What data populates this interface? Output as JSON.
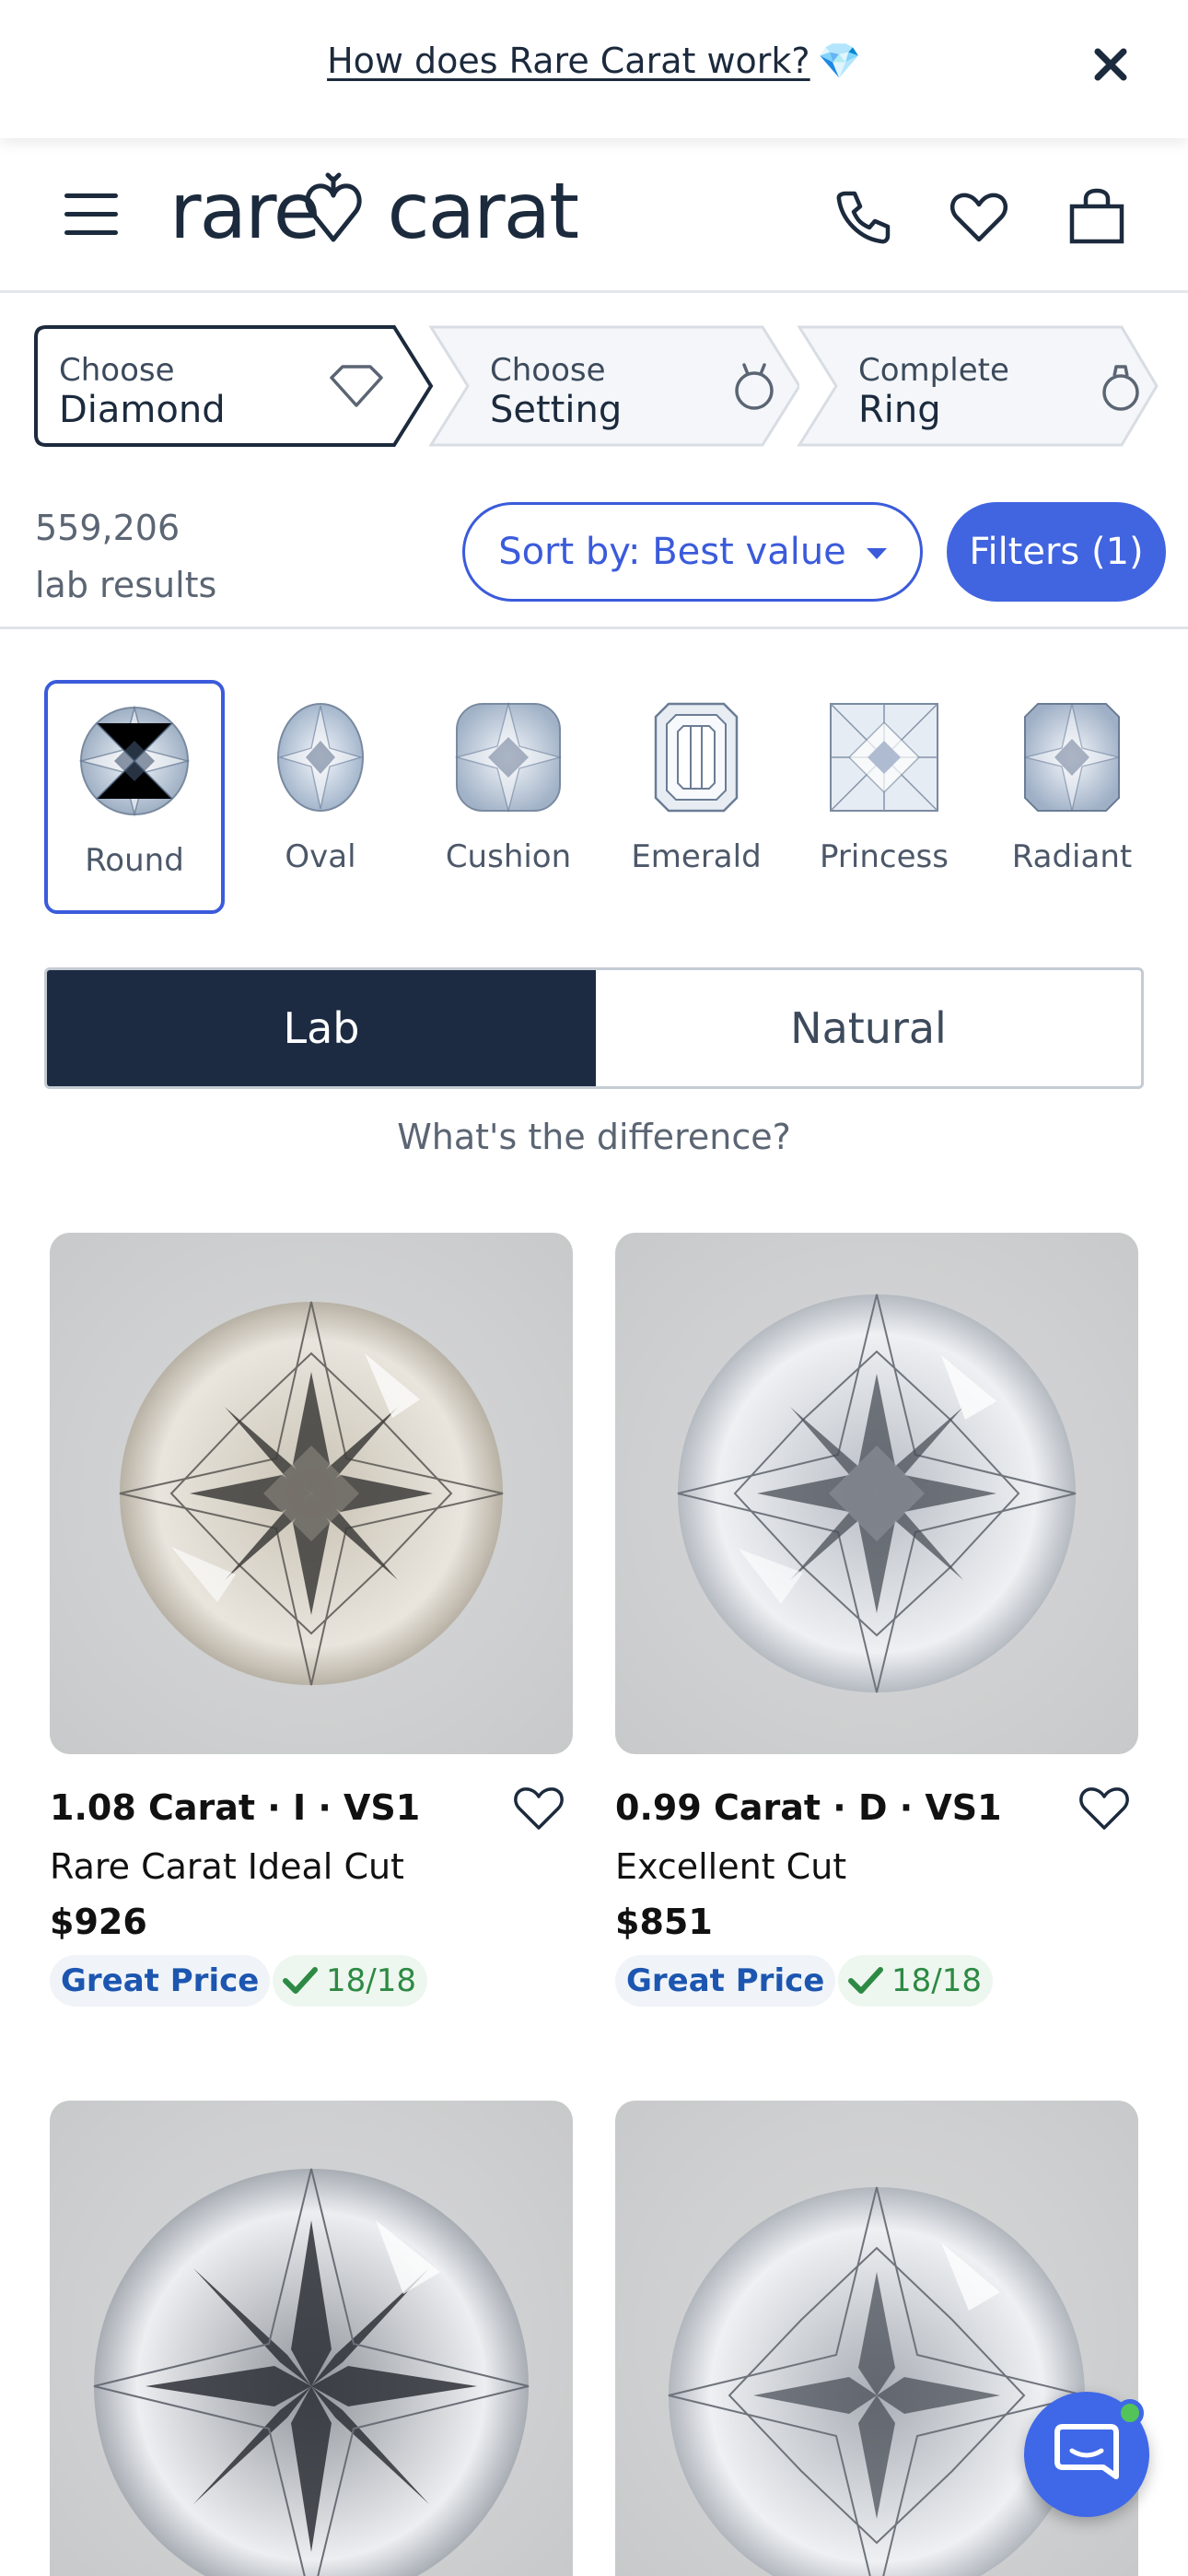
{
  "banner": {
    "link_text": "How does Rare Carat work?",
    "gem_glyph": "💎",
    "close_icon": "close-icon"
  },
  "header": {
    "logo": "rare carat",
    "icons": [
      "menu-icon",
      "phone-icon",
      "heart-icon",
      "bag-icon"
    ]
  },
  "steps": [
    {
      "small": "Choose",
      "big": "Diamond",
      "icon": "diamond-outline-icon",
      "active": true
    },
    {
      "small": "Choose",
      "big": "Setting",
      "icon": "setting-icon",
      "active": false
    },
    {
      "small": "Complete",
      "big": "Ring",
      "icon": "ring-icon",
      "active": false
    }
  ],
  "results": {
    "count": "559,206",
    "label": "lab results"
  },
  "sort": {
    "label": "Sort by: Best value"
  },
  "filters": {
    "label": "Filters (1)"
  },
  "shapes": [
    {
      "label": "Round",
      "selected": true
    },
    {
      "label": "Oval",
      "selected": false
    },
    {
      "label": "Cushion",
      "selected": false
    },
    {
      "label": "Emerald",
      "selected": false
    },
    {
      "label": "Princess",
      "selected": false
    },
    {
      "label": "Radiant",
      "selected": false
    }
  ],
  "toggle": {
    "lab": "Lab",
    "natural": "Natural",
    "active": "Lab"
  },
  "difference_link": "What's the difference?",
  "products": [
    {
      "title": "1.08 Carat · I · VS1",
      "cut": "Rare Carat Ideal Cut",
      "price": "$926",
      "badge": "Great Price",
      "score": "18/18",
      "tint": "warm"
    },
    {
      "title": "0.99 Carat · D · VS1",
      "cut": "Excellent Cut",
      "price": "$851",
      "badge": "Great Price",
      "score": "18/18",
      "tint": "cool"
    },
    {
      "title": "",
      "cut": "",
      "price": "",
      "badge": "",
      "score": "",
      "tint": "cool"
    },
    {
      "title": "",
      "cut": "",
      "price": "",
      "badge": "",
      "score": "",
      "tint": "cool"
    }
  ],
  "colors": {
    "accent": "#3b5bdb",
    "filter_bg": "#4164e0",
    "navy": "#1c2b42",
    "great_price": "#1c56b0",
    "score_green": "#2d8a44",
    "chat": "#3f68e8"
  },
  "chat": {
    "icon": "chat-icon"
  }
}
